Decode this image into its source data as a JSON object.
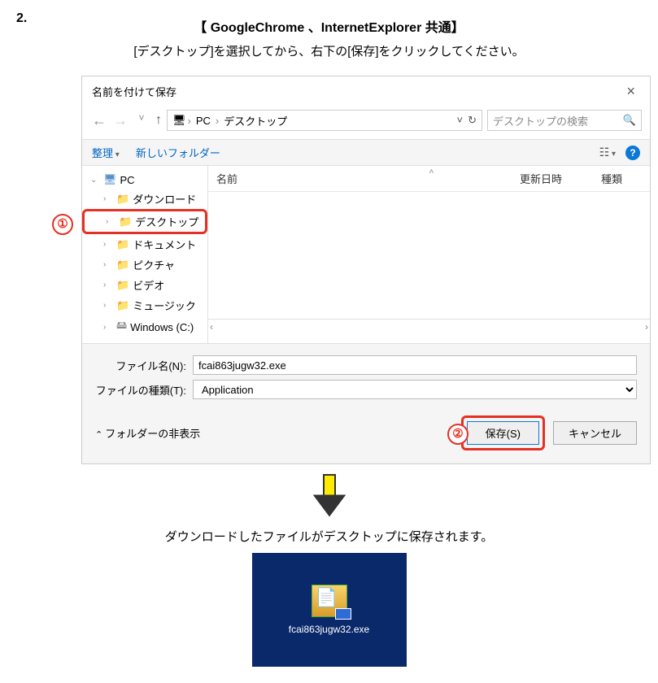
{
  "step": "2.",
  "title": "【 GoogleChrome 、InternetExplorer 共通】",
  "subtitle": "[デスクトップ]を選択してから、右下の[保存]をクリックしてください。",
  "dialog": {
    "title": "名前を付けて保存",
    "close": "×",
    "nav": {
      "back": "←",
      "fwd": "→",
      "dropdown": "˅",
      "up": "↑"
    },
    "breadcrumb": {
      "root_icon": "🖥",
      "pc": "PC",
      "sep": "›",
      "folder": "デスクトップ"
    },
    "address_end": {
      "chev": "˅",
      "refresh": "↻"
    },
    "search": {
      "placeholder": "デスクトップの検索",
      "icon": "🔍"
    },
    "toolbar": {
      "organize": "整理",
      "newfolder": "新しいフォルダー",
      "view": "☷",
      "help": "?"
    },
    "tree": {
      "pc": "PC",
      "items": [
        {
          "icon": "📁",
          "label": "ダウンロード"
        },
        {
          "icon": "📁",
          "label": "デスクトップ"
        },
        {
          "icon": "📁",
          "label": "ドキュメント"
        },
        {
          "icon": "📁",
          "label": "ピクチャ"
        },
        {
          "icon": "📁",
          "label": "ビデオ"
        },
        {
          "icon": "📁",
          "label": "ミュージック"
        }
      ],
      "drive": "Windows (C:)"
    },
    "columns": {
      "name": "名前",
      "date": "更新日時",
      "type": "種類",
      "sort": "˄"
    },
    "scroll": {
      "left": "‹",
      "right": "›"
    },
    "fields": {
      "filename_label": "ファイル名(N):",
      "filename_value": "fcai863jugw32.exe",
      "filetype_label": "ファイルの種類(T):",
      "filetype_value": "Application"
    },
    "hide_folders": "フォルダーの非表示",
    "buttons": {
      "save": "保存(S)",
      "cancel": "キャンセル"
    }
  },
  "callouts": {
    "one": "①",
    "two": "②"
  },
  "result_text": "ダウンロードしたファイルがデスクトップに保存されます。",
  "tile_label": "fcai863jugw32.exe"
}
